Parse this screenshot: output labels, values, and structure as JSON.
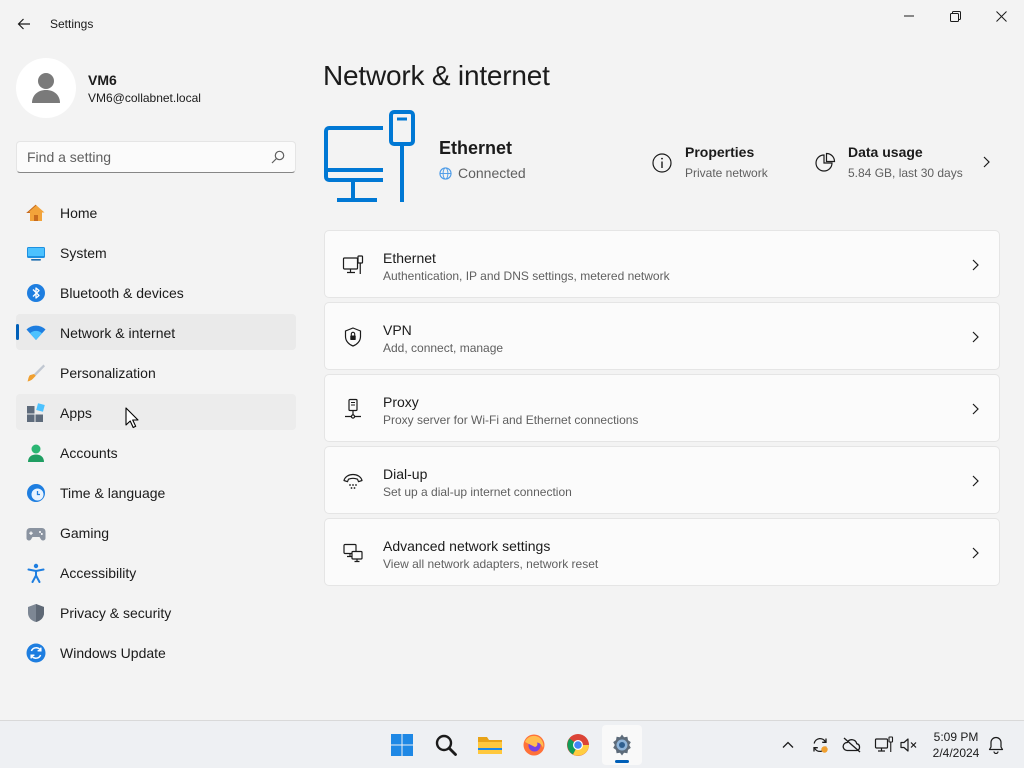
{
  "window": {
    "title": "Settings"
  },
  "profile": {
    "name": "VM6",
    "email": "VM6@collabnet.local"
  },
  "search": {
    "placeholder": "Find a setting"
  },
  "nav": {
    "items": [
      {
        "label": "Home",
        "icon": "home-icon"
      },
      {
        "label": "System",
        "icon": "system-icon"
      },
      {
        "label": "Bluetooth & devices",
        "icon": "bluetooth-icon"
      },
      {
        "label": "Network & internet",
        "icon": "wifi-icon",
        "selected": true
      },
      {
        "label": "Personalization",
        "icon": "brush-icon"
      },
      {
        "label": "Apps",
        "icon": "apps-icon"
      },
      {
        "label": "Accounts",
        "icon": "accounts-icon"
      },
      {
        "label": "Time & language",
        "icon": "clock-globe-icon"
      },
      {
        "label": "Gaming",
        "icon": "gamepad-icon"
      },
      {
        "label": "Accessibility",
        "icon": "accessibility-icon"
      },
      {
        "label": "Privacy & security",
        "icon": "shield-icon"
      },
      {
        "label": "Windows Update",
        "icon": "update-icon"
      }
    ]
  },
  "main": {
    "title": "Network & internet",
    "hero": {
      "name": "Ethernet",
      "status": "Connected",
      "properties": {
        "title": "Properties",
        "subtitle": "Private network"
      },
      "data_usage": {
        "title": "Data usage",
        "subtitle": "5.84 GB, last 30 days"
      }
    },
    "cards": [
      {
        "title": "Ethernet",
        "subtitle": "Authentication, IP and DNS settings, metered network",
        "icon": "ethernet-icon"
      },
      {
        "title": "VPN",
        "subtitle": "Add, connect, manage",
        "icon": "vpn-shield-icon"
      },
      {
        "title": "Proxy",
        "subtitle": "Proxy server for Wi-Fi and Ethernet connections",
        "icon": "proxy-icon"
      },
      {
        "title": "Dial-up",
        "subtitle": "Set up a dial-up internet connection",
        "icon": "dialup-icon"
      },
      {
        "title": "Advanced network settings",
        "subtitle": "View all network adapters, network reset",
        "icon": "advanced-network-icon"
      }
    ]
  },
  "taskbar": {
    "clock": {
      "time": "5:09 PM",
      "date": "2/4/2024"
    }
  },
  "colors": {
    "accent": "#005fb8",
    "hero_icon": "#0078d4"
  }
}
